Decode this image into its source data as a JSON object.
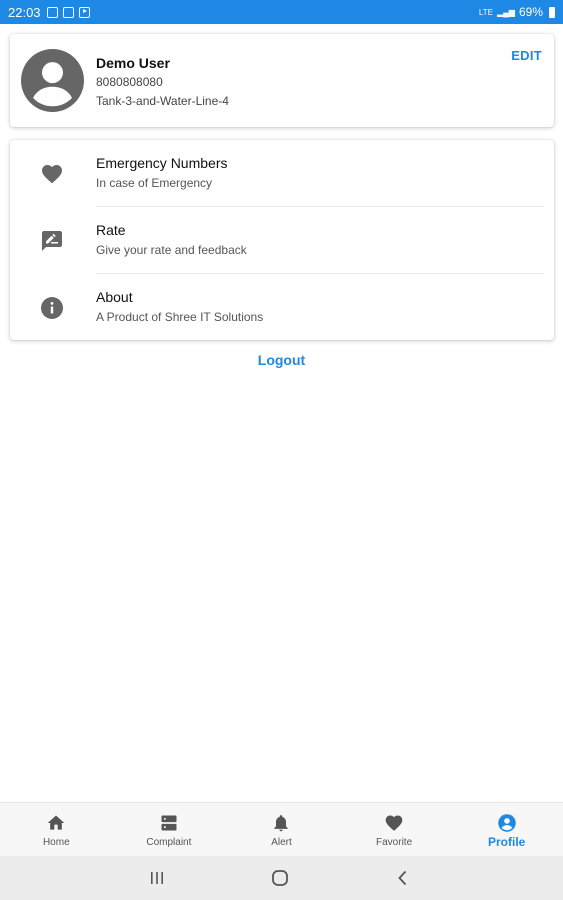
{
  "status_bar": {
    "time": "22:03",
    "network": "LTE",
    "battery": "69%"
  },
  "profile": {
    "name": "Demo User",
    "phone": "8080808080",
    "location": "Tank-3-and-Water-Line-4",
    "edit_label": "EDIT",
    "avatar_icon": "account-circle-icon"
  },
  "menu": {
    "items": [
      {
        "title": "Emergency Numbers",
        "subtitle": "In case of Emergency",
        "icon": "heart-icon"
      },
      {
        "title": "Rate",
        "subtitle": "Give your rate and feedback",
        "icon": "rate-review-icon"
      },
      {
        "title": "About",
        "subtitle": "A Product of Shree IT Solutions",
        "icon": "info-icon"
      }
    ]
  },
  "logout_label": "Logout",
  "bottom_nav": {
    "items": [
      {
        "label": "Home",
        "icon": "home-icon",
        "active": false
      },
      {
        "label": "Complaint",
        "icon": "server-icon",
        "active": false
      },
      {
        "label": "Alert",
        "icon": "bell-icon",
        "active": false
      },
      {
        "label": "Favorite",
        "icon": "heart-icon",
        "active": false
      },
      {
        "label": "Profile",
        "icon": "account-circle-icon",
        "active": true
      }
    ]
  },
  "colors": {
    "accent": "#1e88e5",
    "icon_gray": "#666666",
    "status_bar": "#1e88e5"
  }
}
